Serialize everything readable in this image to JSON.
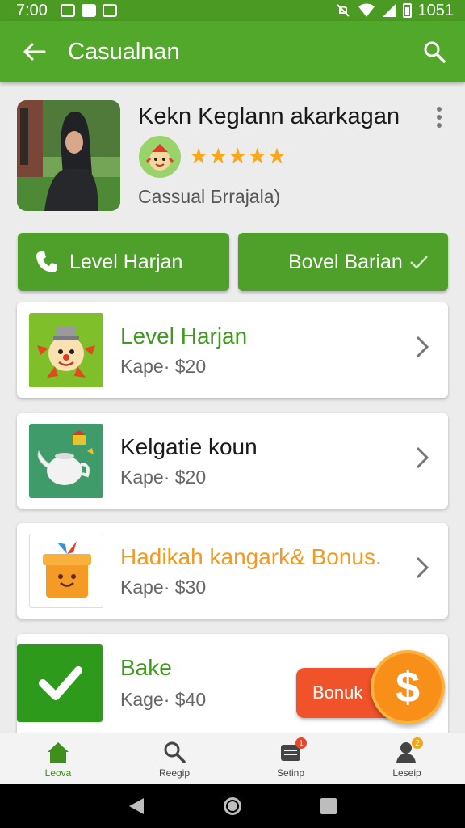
{
  "status_bar": {
    "time": "7:00",
    "battery_level": "1051"
  },
  "appbar": {
    "title": "Casualnan"
  },
  "profile": {
    "name": "Kekn Keglann akarkagan",
    "rating": 5,
    "stars": "★★★★★",
    "subtitle": "Cassual Бrrajala)"
  },
  "actions": {
    "primary": "Level Harjan",
    "secondary": "Bovel Barian"
  },
  "items": [
    {
      "title": "Level Harjan",
      "price": "Kape· $20",
      "title_color": "#3f9a1f"
    },
    {
      "title": "Kelgatie koun",
      "price": "Kape· $20",
      "title_color": "#1a1a1a"
    },
    {
      "title": "Hadikah kangark& Bonus.",
      "price": "Kape· $30",
      "title_color": "#f39a1e"
    },
    {
      "title": "Bake",
      "price": "Kage· $40",
      "title_color": "#3f9a1f"
    }
  ],
  "bonus": {
    "label": "Bonuk",
    "coin": "$"
  },
  "nav": [
    {
      "label": "Leova",
      "active": true
    },
    {
      "label": "Reegip",
      "badge": ""
    },
    {
      "label": "Setinp",
      "badge": "1"
    },
    {
      "label": "Leseip",
      "badge": "2"
    }
  ],
  "colors": {
    "primary": "#52a82a",
    "accent": "#f7a81b",
    "bonus": "#f0522a",
    "coin": "#f78f18"
  }
}
